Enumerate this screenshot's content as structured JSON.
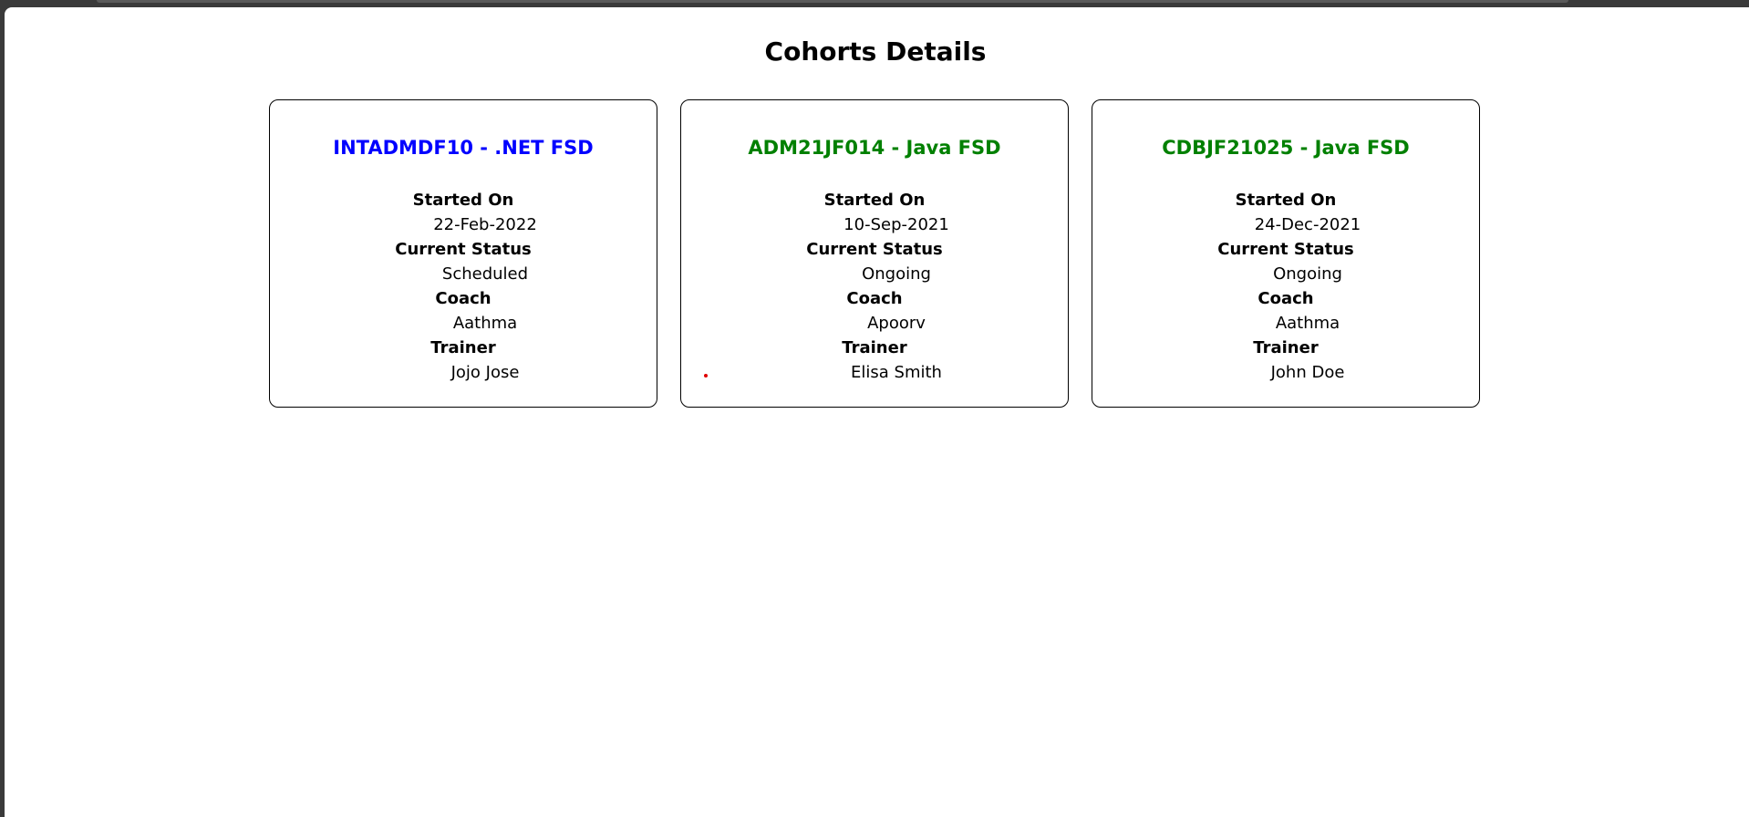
{
  "page": {
    "title": "Cohorts Details"
  },
  "labels": {
    "started_on": "Started On",
    "current_status": "Current Status",
    "coach": "Coach",
    "trainer": "Trainer"
  },
  "colors": {
    "title_blue": "#0000ff",
    "title_green": "#008000"
  },
  "cohorts": [
    {
      "title": "INTADMDF10 - .NET FSD",
      "title_color": "blue",
      "started_on": "22-Feb-2022",
      "current_status": "Scheduled",
      "coach": "Aathma",
      "trainer": "Jojo Jose"
    },
    {
      "title": "ADM21JF014 - Java FSD",
      "title_color": "green",
      "started_on": "10-Sep-2021",
      "current_status": "Ongoing",
      "coach": "Apoorv",
      "trainer": "Elisa Smith"
    },
    {
      "title": "CDBJF21025 - Java FSD",
      "title_color": "green",
      "started_on": "24-Dec-2021",
      "current_status": "Ongoing",
      "coach": "Aathma",
      "trainer": "John Doe"
    }
  ]
}
